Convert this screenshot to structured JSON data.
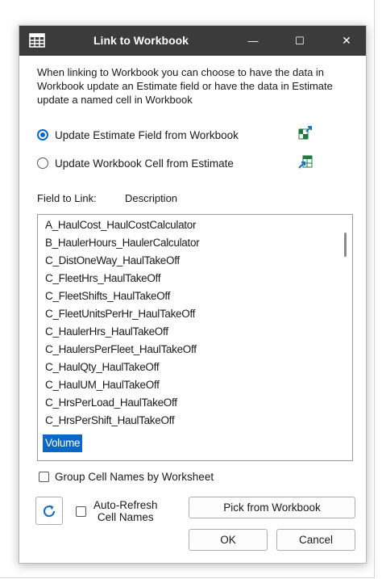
{
  "window": {
    "title": "Link to Workbook",
    "minimize_glyph": "—",
    "maximize_glyph": "☐",
    "close_glyph": "✕",
    "icon": "spreadsheet-icon"
  },
  "description": "When linking to Workbook you can choose to have the data in Workbook update an Estimate field or have the data in Estimate update a named cell in Workbook",
  "options": [
    {
      "label": "Update Estimate Field from Workbook",
      "checked": true,
      "icon": "import-from-workbook-icon"
    },
    {
      "label": "Update Workbook Cell from Estimate",
      "checked": false,
      "icon": "export-to-workbook-icon"
    }
  ],
  "field": {
    "label": "Field to Link:",
    "value": "Description"
  },
  "list": {
    "items": [
      "A_HaulCost_HaulCostCalculator",
      "B_HaulerHours_HaulerCalculator",
      "C_DistOneWay_HaulTakeOff",
      "C_FleetHrs_HaulTakeOff",
      "C_FleetShifts_HaulTakeOff",
      "C_FleetUnitsPerHr_HaulTakeOff",
      "C_HaulerHrs_HaulTakeOff",
      "C_HaulersPerFleet_HaulTakeOff",
      "C_HaulQty_HaulTakeOff",
      "C_HaulUM_HaulTakeOff",
      "C_HrsPerLoad_HaulTakeOff",
      "C_HrsPerShift_HaulTakeOff",
      "Volume"
    ],
    "selected": "Volume"
  },
  "group_checkbox": {
    "label": "Group Cell Names by Worksheet",
    "checked": false
  },
  "auto_refresh": {
    "line1": "Auto-Refresh",
    "line2": "Cell Names",
    "checked": false
  },
  "buttons": {
    "refresh_icon": "refresh-icon",
    "pick": "Pick from Workbook",
    "ok": "OK",
    "cancel": "Cancel"
  },
  "colors": {
    "titlebar": "#3b3b3b",
    "accent": "#0c67c7",
    "icon_green": "#1e7b3c"
  }
}
